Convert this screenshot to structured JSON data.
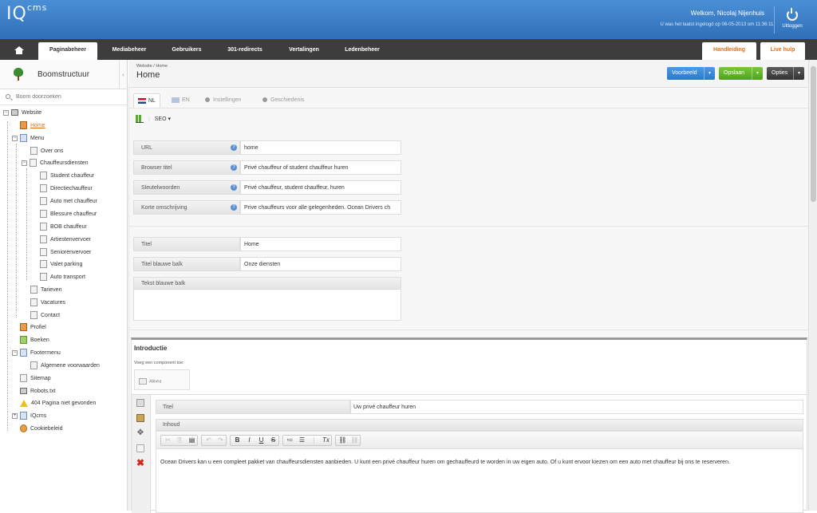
{
  "header": {
    "logo_main": "IQ",
    "logo_sup": "cms",
    "welcome": "Welkom, Nicolaj Nijenhuis",
    "last_login": "U was het laatst ingelogd op 06-05-2013 om 11:36:11.",
    "logout_label": "Uitloggen"
  },
  "nav": {
    "tabs": [
      "Paginabeheer",
      "Mediabeheer",
      "Gebruikers",
      "301-redirects",
      "Vertalingen",
      "Ledenbeheer"
    ],
    "manual": "Handleiding",
    "live_help": "Live hulp"
  },
  "sidebar": {
    "title": "Boomstructuur",
    "search_placeholder": "Boom doorzoeken",
    "nodes": [
      {
        "label": "Website",
        "icon": "server-icon"
      },
      {
        "label": "Home",
        "icon": "house-icon"
      },
      {
        "label": "Menu",
        "icon": "folder-icon"
      },
      {
        "label": "Over ons",
        "icon": "page-icon"
      },
      {
        "label": "Chauffeursdiensten",
        "icon": "page-icon"
      },
      {
        "label": "Student chauffeur",
        "icon": "page-icon"
      },
      {
        "label": "Directiechauffeur",
        "icon": "page-icon"
      },
      {
        "label": "Auto met chauffeur",
        "icon": "page-icon"
      },
      {
        "label": "Blessure chauffeur",
        "icon": "page-icon"
      },
      {
        "label": "BOB chauffeur",
        "icon": "page-icon"
      },
      {
        "label": "Artiestenvervoer",
        "icon": "page-icon"
      },
      {
        "label": "Seniorenvervoer",
        "icon": "page-icon"
      },
      {
        "label": "Valet parking",
        "icon": "page-icon"
      },
      {
        "label": "Auto transport",
        "icon": "page-icon"
      },
      {
        "label": "Tarieven",
        "icon": "page-icon"
      },
      {
        "label": "Vacatures",
        "icon": "page-icon"
      },
      {
        "label": "Contact",
        "icon": "page-icon"
      },
      {
        "label": "Profiel",
        "icon": "profile-icon"
      },
      {
        "label": "Boeken",
        "icon": "image-icon"
      },
      {
        "label": "Footermenu",
        "icon": "folder-icon"
      },
      {
        "label": "Algemene voorwaarden",
        "icon": "page-icon"
      },
      {
        "label": "Sitemap",
        "icon": "sitemap-icon"
      },
      {
        "label": "Robots.txt",
        "icon": "robot-icon"
      },
      {
        "label": "404 Pagina niet gevonden",
        "icon": "warning-icon"
      },
      {
        "label": "IQcms",
        "icon": "folder-icon"
      },
      {
        "label": "Cookiebeleid",
        "icon": "cookie-icon"
      }
    ]
  },
  "main": {
    "breadcrumb": "Website / Home",
    "title": "Home",
    "buttons": {
      "preview": "Voorbeeld",
      "save": "Opslaan",
      "options": "Opties"
    },
    "lang_tabs": [
      "NL",
      "EN",
      "Instellingen",
      "Geschiedenis"
    ],
    "seo_label": "SEO",
    "seo_fields": [
      {
        "label": "URL",
        "value": "home"
      },
      {
        "label": "Browser titel",
        "value": "Privé chauffeur of student chauffeur huren"
      },
      {
        "label": "Sleutelwoorden",
        "value": "Privé chauffeur, student chauffeur, huren"
      },
      {
        "label": "Korte omschrijving",
        "value": "Prive chauffeurs voor alle gelegenheden. Ocean Drivers ch"
      }
    ],
    "page_fields": [
      {
        "label": "Titel",
        "value": "Home"
      },
      {
        "label": "Titel blauwe balk",
        "value": "Onze diensten"
      }
    ],
    "tekst_label": "Tekst blauwe balk",
    "intro": {
      "title": "Introductie",
      "add_component": "Voeg een component toe:",
      "component": "Alinea",
      "titel_label": "Titel",
      "titel_value": "Uw privé chauffeur huren",
      "inhoud_label": "Inhoud",
      "body": "Ocean Drivers kan u een compleet pakket van chauffeursdiensten aanbieden. U kunt een privé chauffeur huren om gechauffeurd te worden in uw eigen auto. Of u kunt ervoor kiezen om een auto met chauffeur bij ons te reserveren."
    }
  }
}
